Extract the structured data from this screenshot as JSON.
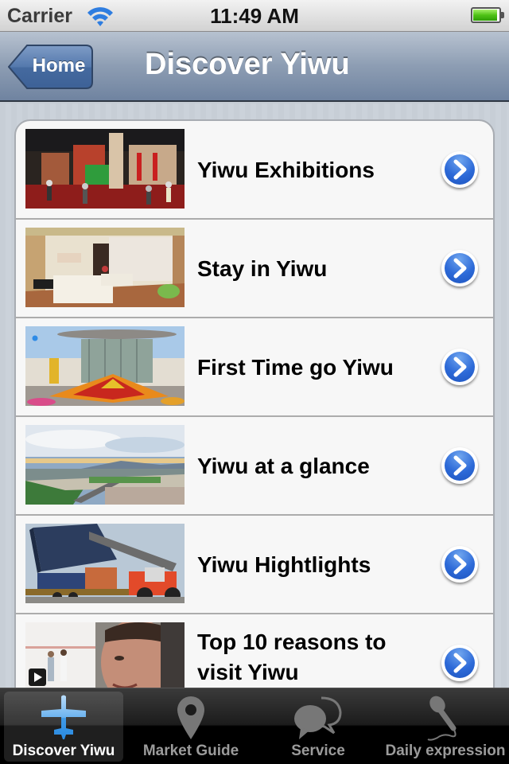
{
  "status_bar": {
    "carrier": "Carrier",
    "time": "11:49 AM",
    "battery_level": 1.0
  },
  "nav": {
    "back_label": "Home",
    "title": "Discover Yiwu"
  },
  "list": {
    "items": [
      {
        "title": "Yiwu Exhibitions",
        "thumbnail": "exhibition-hall-photo"
      },
      {
        "title": "Stay in Yiwu",
        "thumbnail": "hotel-room-photo"
      },
      {
        "title": "First Time go Yiwu",
        "thumbnail": "trade-center-flowerbed-photo"
      },
      {
        "title": "Yiwu at a glance",
        "thumbnail": "city-panorama-photo"
      },
      {
        "title": "Yiwu Hightlights",
        "thumbnail": "container-crane-photo"
      },
      {
        "title": "Top 10 reasons to visit Yiwu",
        "thumbnail": "video-man-photo",
        "has_video": true
      }
    ]
  },
  "tab_bar": {
    "selected": 0,
    "tabs": [
      {
        "label": "Discover Yiwu",
        "icon": "airplane-icon"
      },
      {
        "label": "Market Guide",
        "icon": "map-pin-icon"
      },
      {
        "label": "Service",
        "icon": "chat-bubbles-icon"
      },
      {
        "label": "Daily expression",
        "icon": "microphone-icon"
      }
    ]
  },
  "colors": {
    "nav_tint": "#6f83a0",
    "disclosure_blue": "#2d6ad8",
    "battery_green": "#4fc216",
    "tab_active_icon": "#5aaaf0"
  }
}
